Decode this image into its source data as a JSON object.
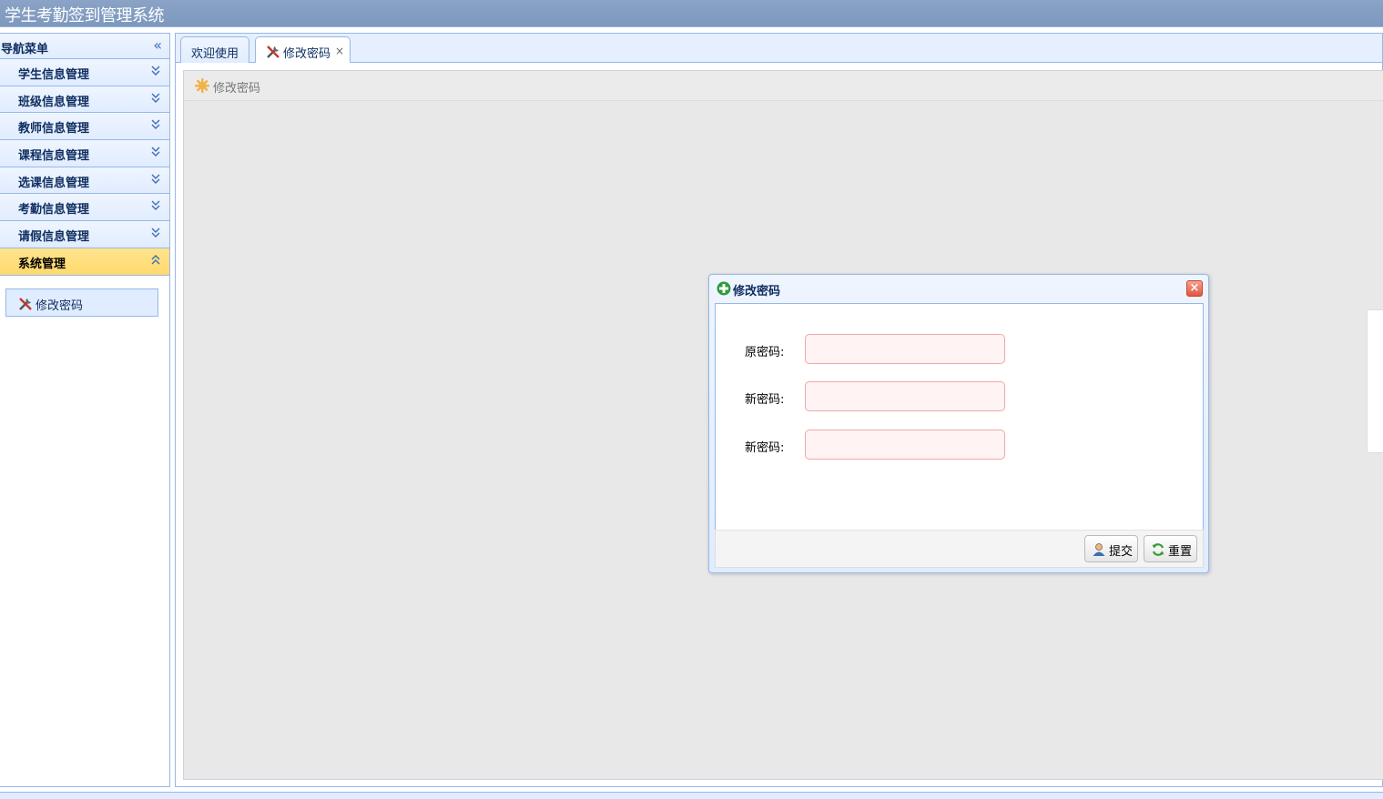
{
  "app": {
    "title": "学生考勤签到管理系统"
  },
  "sidebar": {
    "title": "导航菜单",
    "items": [
      {
        "label": "学生信息管理"
      },
      {
        "label": "班级信息管理"
      },
      {
        "label": "教师信息管理"
      },
      {
        "label": "课程信息管理"
      },
      {
        "label": "选课信息管理"
      },
      {
        "label": "考勤信息管理"
      },
      {
        "label": "请假信息管理"
      },
      {
        "label": "系统管理"
      }
    ],
    "sub_items": [
      {
        "label": "修改密码"
      }
    ]
  },
  "tabs": [
    {
      "label": "欢迎使用"
    },
    {
      "label": "修改密码",
      "close": "×"
    }
  ],
  "panel": {
    "title": "修改密码"
  },
  "dialog": {
    "title": "修改密码",
    "close": "×",
    "fields": [
      {
        "label": "原密码:",
        "value": ""
      },
      {
        "label": "新密码:",
        "value": ""
      },
      {
        "label": "新密码:",
        "value": ""
      }
    ],
    "buttons": {
      "submit": "提交",
      "reset": "重置"
    }
  },
  "colors": {
    "header": "#7d98bf",
    "border": "#95b8e7",
    "active_item": "#ffd96e",
    "input_invalid": "#fff3f3"
  }
}
